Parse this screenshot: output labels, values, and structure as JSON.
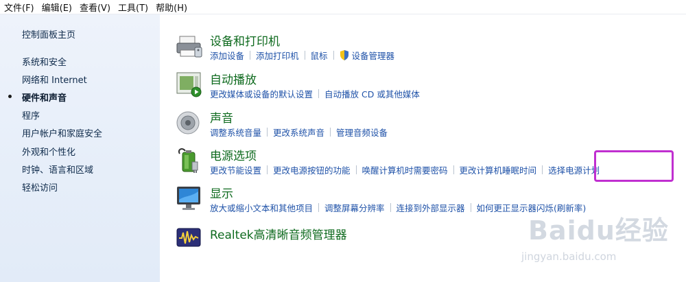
{
  "menubar": {
    "items": [
      "文件(F)",
      "编辑(E)",
      "查看(V)",
      "工具(T)",
      "帮助(H)"
    ]
  },
  "sidebar": {
    "home": "控制面板主页",
    "items": [
      {
        "label": "系统和安全",
        "active": false
      },
      {
        "label": "网络和 Internet",
        "active": false
      },
      {
        "label": "硬件和声音",
        "active": true
      },
      {
        "label": "程序",
        "active": false
      },
      {
        "label": "用户帐户和家庭安全",
        "active": false
      },
      {
        "label": "外观和个性化",
        "active": false
      },
      {
        "label": "时钟、语言和区域",
        "active": false
      },
      {
        "label": "轻松访问",
        "active": false
      }
    ]
  },
  "categories": [
    {
      "title": "设备和打印机",
      "icon": "printer-icon",
      "links": [
        "添加设备",
        "添加打印机",
        "鼠标",
        "设备管理器"
      ]
    },
    {
      "title": "自动播放",
      "icon": "autoplay-icon",
      "links": [
        "更改媒体或设备的默认设置",
        "自动播放 CD 或其他媒体"
      ]
    },
    {
      "title": "声音",
      "icon": "speaker-icon",
      "links": [
        "调整系统音量",
        "更改系统声音",
        "管理音频设备"
      ]
    },
    {
      "title": "电源选项",
      "icon": "battery-icon",
      "links": [
        "更改节能设置",
        "更改电源按钮的功能",
        "唤醒计算机时需要密码",
        "更改计算机睡眠时间",
        "选择电源计划"
      ]
    },
    {
      "title": "显示",
      "icon": "monitor-icon",
      "links": [
        "放大或缩小文本和其他项目",
        "调整屏幕分辨率",
        "连接到外部显示器",
        "如何更正显示器闪烁(刷新率)"
      ]
    },
    {
      "title": "Realtek高清晰音频管理器",
      "icon": "realtek-audio-icon",
      "links": []
    }
  ],
  "watermark": {
    "logo": "Baidu经验",
    "url": "jingyan.baidu.com"
  },
  "colors": {
    "link": "#1f52a8",
    "title": "#0e6a1e",
    "highlight": "#c02fd0"
  }
}
